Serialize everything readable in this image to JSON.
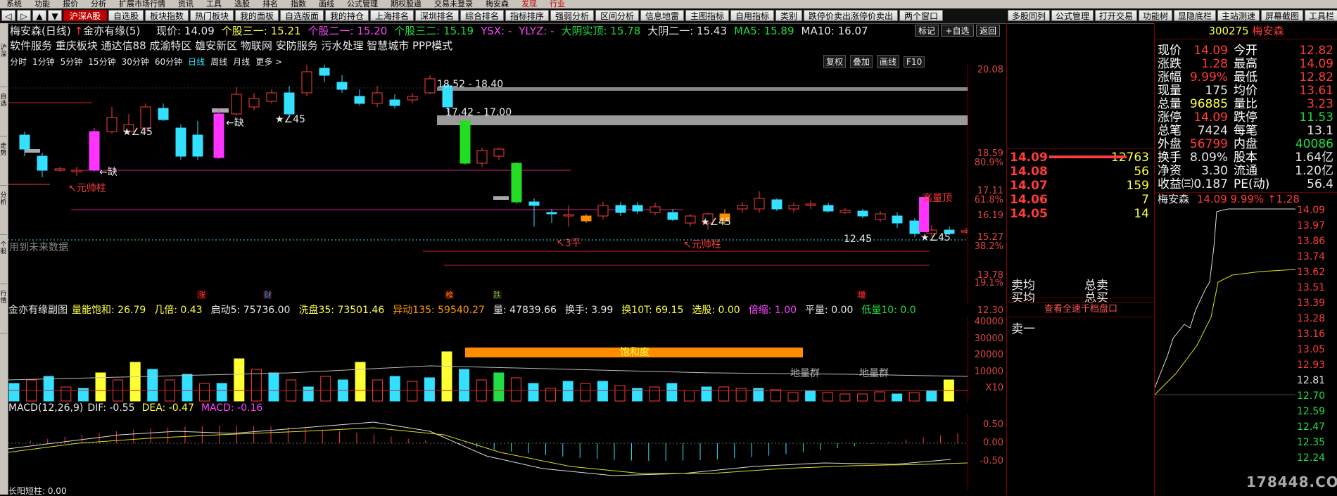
{
  "menu": {
    "items": [
      "系统",
      "功能",
      "报价",
      "分析",
      "扩展市场行情",
      "资讯",
      "工具",
      "选股",
      "排名",
      "指数",
      "画线",
      "公式管理",
      "期权股道",
      "交易未登录",
      "梅安森"
    ],
    "red_items": [
      "发现",
      "行业"
    ]
  },
  "toolbar": {
    "left_buttons": [
      "◁",
      "▷",
      "▲",
      "▼",
      "沪深A股",
      "自选股",
      "板块指数",
      "热门板块",
      "我的面板",
      "自选版面",
      "我的持仓",
      "上海排名",
      "深圳排名",
      "综合排名",
      "指标排序",
      "强弱分析",
      "区间分析",
      "信息地雷",
      "主图指标",
      "自用指标",
      "类别",
      "跌停价卖出涨停价卖出",
      "两个窗口"
    ],
    "right_buttons": [
      "多股同列",
      "公式管理",
      "打开交易",
      "功能树",
      "显隐底栏",
      "主站测速",
      "屏幕截图",
      "工具栏"
    ]
  },
  "left_tabs": [
    "沪深",
    "自选",
    "走势",
    "分析",
    "个股",
    "行情"
  ],
  "chart_header": {
    "stock": "梅安森(日线)",
    "indicator": "金亦有缘(5)",
    "items": [
      {
        "label": "现价: 14.09",
        "color": "#e8e8e8"
      },
      {
        "label": "个股三一: 15.21",
        "color": "#ffff44"
      },
      {
        "label": "个股二一: 15.20",
        "color": "#ff44ff"
      },
      {
        "label": "个股三二: 15.19",
        "color": "#22dd44"
      },
      {
        "label": "YSX: -",
        "color": "#ff44ff"
      },
      {
        "label": "YLYZ: -",
        "color": "#ff44ff"
      },
      {
        "label": "大阴实顶: 15.78",
        "color": "#22dd44"
      },
      {
        "label": "大阴二一: 15.43",
        "color": "#e8e8e8"
      },
      {
        "label": "MA5: 15.89",
        "color": "#22dd44"
      },
      {
        "label": "MA10: 16.07",
        "color": "#e8e8e8"
      }
    ],
    "buttons": [
      "标记",
      "+自选",
      "返回"
    ]
  },
  "concepts": "软件服务 重庆板块 通达信88 成渝特区 雄安新区 物联网 安防服务 污水处理 智慧城市 PPP模式",
  "period_tabs": [
    "分时",
    "1分钟",
    "5分钟",
    "15分钟",
    "30分钟",
    "60分钟",
    "日线",
    "周线",
    "月线",
    "更多 >"
  ],
  "active_period": "日线",
  "right_tools": [
    "复权",
    "叠加",
    "画线",
    "F10"
  ],
  "price_axis": [
    "20.08",
    "18.59",
    "80.9%",
    "17.11",
    "61.8%",
    "16.19",
    "15.27",
    "38.2%",
    "13.78",
    "19.1%",
    "12.30"
  ],
  "price_labels": {
    "range1": "18.52 - 18.40",
    "range2": "17.42 - 17.00",
    "low": "12.45",
    "queding": "←缺",
    "yuanshuai": "↖元帅柱",
    "sanping": "↖3平",
    "star45": "★∠45",
    "gaoliang": "高量顶",
    "future": "用到未来数据",
    "marks": [
      "涨",
      "财",
      "榜",
      "跌",
      "增"
    ]
  },
  "sub1": {
    "title": "金亦有缘副图",
    "items": [
      {
        "label": "量能饱和: 26.79",
        "color": "#ffff44"
      },
      {
        "label": "几倍: 0.43",
        "color": "#ffff44"
      },
      {
        "label": "启动5: 75736.00",
        "color": "#e8e8e8"
      },
      {
        "label": "洗盘35: 73501.46",
        "color": "#ffff44"
      },
      {
        "label": "异动135: 59540.27",
        "color": "#ff9900"
      },
      {
        "label": "量: 47839.66",
        "color": "#e8e8e8"
      },
      {
        "label": "换手: 3.99",
        "color": "#e8e8e8"
      },
      {
        "label": "换10T: 69.15",
        "color": "#ffff44"
      },
      {
        "label": "选股: 0.00",
        "color": "#ffff44"
      },
      {
        "label": "倍缩: 1.00",
        "color": "#ff44ff"
      },
      {
        "label": "平量: 0.00",
        "color": "#e8e8e8"
      },
      {
        "label": "低量10: 0.0",
        "color": "#22dd44"
      }
    ],
    "banner": "饱和度",
    "ground1": "地量群",
    "ground2": "地量群",
    "axis": [
      "40000",
      "30000",
      "20000",
      "10000",
      "X10"
    ]
  },
  "macd": {
    "label": "MACD(12,26,9)",
    "dif": "DIF: -0.55",
    "dea": "DEA: -0.47",
    "macd": "MACD: -0.16",
    "axis": [
      "0.50",
      "0.00",
      "-0.50"
    ],
    "footer": "长阳短柱: 0.00"
  },
  "quote": {
    "code": "300275",
    "name": "梅安森",
    "rows": [
      {
        "k": "现价",
        "v": "14.09",
        "vc": "#ff3b3b",
        "k2": "今开",
        "v2": "12.82",
        "v2c": "#ff3b3b"
      },
      {
        "k": "涨跌",
        "v": "1.28",
        "vc": "#ff3b3b",
        "k2": "最高",
        "v2": "14.09",
        "v2c": "#ff3b3b"
      },
      {
        "k": "涨幅",
        "v": "9.99%",
        "vc": "#ff3b3b",
        "k2": "最低",
        "v2": "12.82",
        "v2c": "#ff3b3b"
      },
      {
        "k": "现量",
        "v": "175",
        "vc": "#e8e8e8",
        "k2": "均价",
        "v2": "13.61",
        "v2c": "#ff3b3b"
      },
      {
        "k": "总量",
        "v": "96885",
        "vc": "#ffff44",
        "k2": "量比",
        "v2": "3.23",
        "v2c": "#ff3b3b"
      },
      {
        "k": "涨停",
        "v": "14.09",
        "vc": "#ff3b3b",
        "k2": "跌停",
        "v2": "11.53",
        "v2c": "#22dd44"
      },
      {
        "k": "总笔",
        "v": "7424",
        "vc": "#e8e8e8",
        "k2": "每笔",
        "v2": "13.1",
        "v2c": "#e8e8e8"
      },
      {
        "k": "外盘",
        "v": "56799",
        "vc": "#ff3b3b",
        "k2": "内盘",
        "v2": "40086",
        "v2c": "#22dd44"
      },
      {
        "k": "换手",
        "v": "8.09%",
        "vc": "#e8e8e8",
        "k2": "股本",
        "v2": "1.64亿",
        "v2c": "#e8e8e8"
      },
      {
        "k": "净资",
        "v": "3.30",
        "vc": "#e8e8e8",
        "k2": "流通",
        "v2": "1.20亿",
        "v2c": "#e8e8e8"
      },
      {
        "k": "收益㈢",
        "v": "0.187",
        "vc": "#e8e8e8",
        "k2": "PE(动)",
        "v2": "56.4",
        "v2c": "#e8e8e8"
      }
    ],
    "mini_title": "梅安森",
    "mini_price": "14.09",
    "mini_pct": "9.99%",
    "mini_chg": "↑1.28",
    "mini_axis": [
      "14.09",
      "13.97",
      "13.86",
      "13.74",
      "13.62",
      "13.51",
      "13.39",
      "13.28",
      "13.16",
      "13.05",
      "12.93",
      "12.81",
      "12.70",
      "12.59",
      "12.47",
      "12.35",
      "12.24"
    ],
    "watermark": "178448.COM"
  },
  "order_book": {
    "bids": [
      {
        "p": "14.09",
        "q": "12763"
      },
      {
        "p": "14.08",
        "q": "56"
      },
      {
        "p": "14.07",
        "q": "159"
      },
      {
        "p": "14.06",
        "q": "7"
      },
      {
        "p": "14.05",
        "q": "14"
      }
    ],
    "buy_sell": [
      "卖均",
      "总卖",
      "买均",
      "总买"
    ],
    "view_all": "查看全速千档盘口",
    "sell1": "卖一"
  },
  "colors": {
    "up": "#33e0ff",
    "down": "#ff3b3b",
    "magenta": "#ff33ff",
    "green": "#22dd22",
    "orange": "#ff8c00",
    "axis": "#cc2222"
  }
}
